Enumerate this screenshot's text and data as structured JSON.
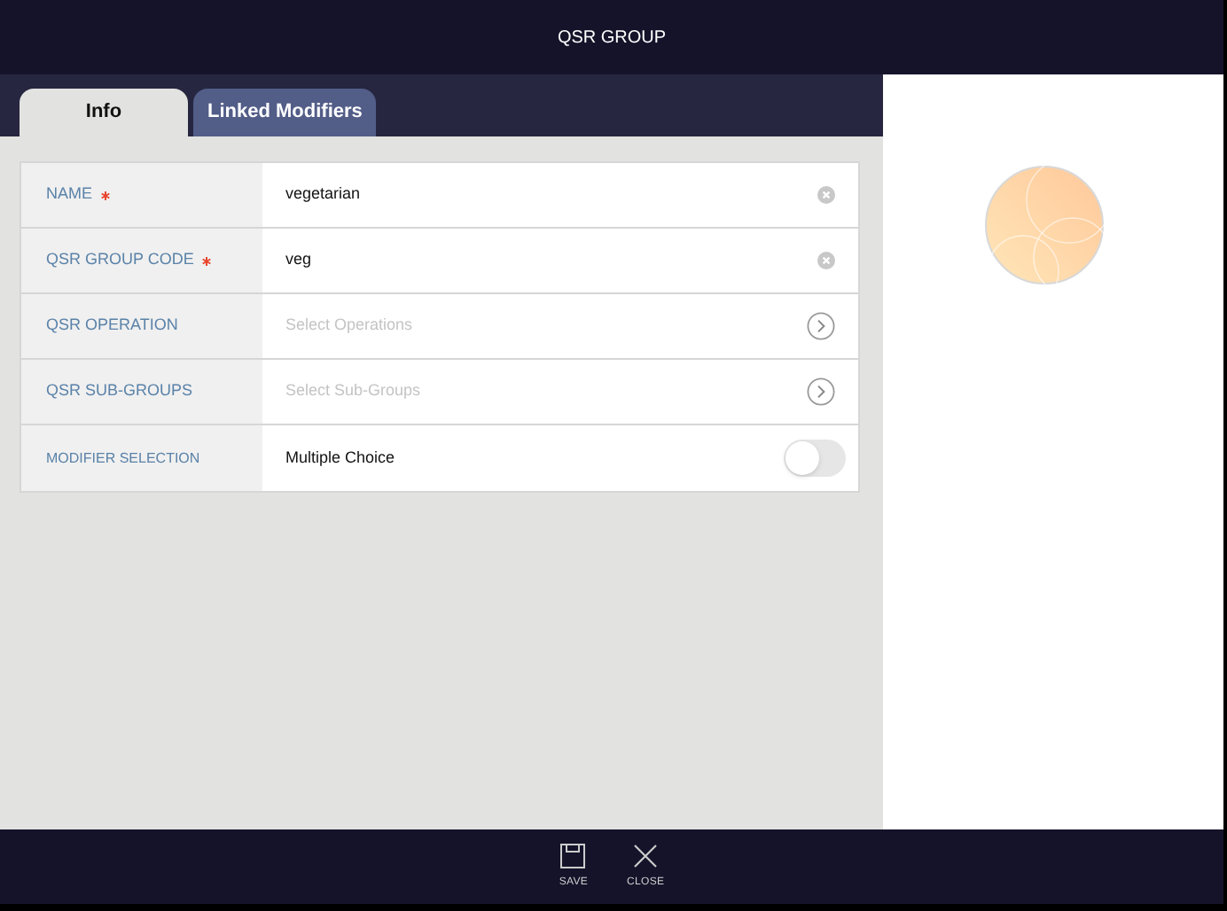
{
  "header": {
    "title": "QSR GROUP"
  },
  "tabs": [
    {
      "label": "Info",
      "selected": true
    },
    {
      "label": "Linked Modifiers",
      "selected": false
    }
  ],
  "fields": [
    {
      "kind": "text",
      "label": "NAME",
      "required": true,
      "value": "vegetarian"
    },
    {
      "kind": "text",
      "label": "QSR GROUP CODE",
      "required": true,
      "value": "veg"
    },
    {
      "kind": "select",
      "label": "QSR OPERATION",
      "required": false,
      "placeholder": "Select Operations"
    },
    {
      "kind": "select",
      "label": "QSR SUB-GROUPS",
      "required": false,
      "placeholder": "Select Sub-Groups"
    },
    {
      "kind": "toggle",
      "label": "MODIFIER SELECTION",
      "required": false,
      "value": "Multiple Choice",
      "on": false
    }
  ],
  "toolbar": [
    {
      "kind": "save",
      "label": "SAVE"
    },
    {
      "kind": "close",
      "label": "CLOSE"
    }
  ]
}
